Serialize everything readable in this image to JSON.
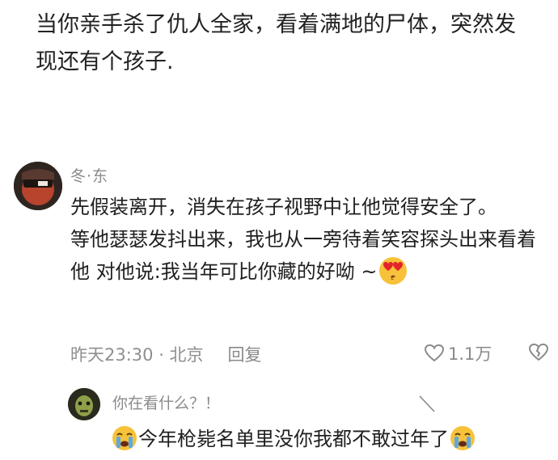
{
  "post": {
    "text": "当你亲手杀了仇人全家，看着满地的尸体，突然发现还有个孩子."
  },
  "comment": {
    "username": "冬·东",
    "paragraph1": "先假装离开，消失在孩子视野中让他觉得安全了。",
    "paragraph2": "等他瑟瑟发抖出来，我也从一旁待着笑容探头出来看着他 对他说:我当年可比你藏的好呦 ~",
    "timestamp": "昨天23:30 · 北京",
    "reply_label": "回复",
    "like_count": "1.1万",
    "emoji": "heart-eyes-emoji"
  },
  "reply": {
    "username": "你在看什么？！",
    "text": "今年枪毙名单里没你我都不敢过年了",
    "emoji": "crying-emoji"
  },
  "icons": {
    "like": "heart-outline-icon",
    "dislike": "broken-heart-icon"
  },
  "colors": {
    "text_primary": "#1f1f1f",
    "text_secondary": "#8a8a8a",
    "emoji_yellow": "#f7c23a",
    "heart_red": "#e3242b",
    "tear_blue": "#5aa9e6"
  }
}
